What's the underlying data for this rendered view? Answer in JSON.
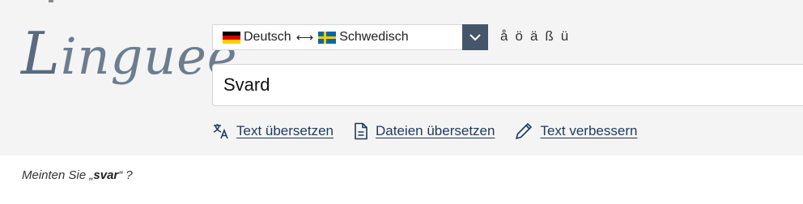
{
  "logo": {
    "first_letter": "L",
    "rest": "inguee"
  },
  "language_selector": {
    "source_flag_icon": "german-flag-icon",
    "source_label": "Deutsch",
    "swap_icon": "bidirectional-arrow-icon",
    "target_flag_icon": "swedish-flag-icon",
    "target_label": "Schwedisch",
    "dropdown_icon": "chevron-down-icon"
  },
  "special_chars": [
    "å",
    "ö",
    "ä",
    "ß",
    "ü"
  ],
  "search": {
    "value": "Svard"
  },
  "tools": [
    {
      "icon": "translate-icon",
      "label": "Text übersetzen"
    },
    {
      "icon": "document-icon",
      "label": "Dateien übersetzen"
    },
    {
      "icon": "pencil-icon",
      "label": "Text verbessern"
    }
  ],
  "suggestion": {
    "prefix": "Meinten Sie ",
    "open_quote": "„",
    "term": "svar",
    "close_quote": "“ ?"
  },
  "colors": {
    "header_bg": "#f4f4f4",
    "link": "#1f3a5c",
    "logo": "#6d7d90",
    "dropdown_bg": "#45566a"
  }
}
